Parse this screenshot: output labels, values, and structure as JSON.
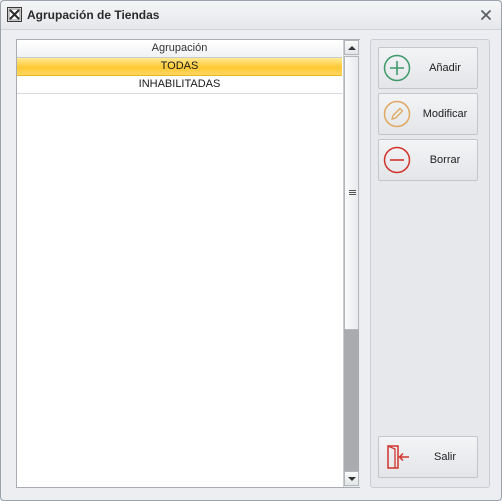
{
  "window": {
    "title": "Agrupación de Tiendas"
  },
  "grid": {
    "header": "Agrupación",
    "rows": [
      "TODAS",
      "INHABILITADAS"
    ],
    "selected_index": 0
  },
  "buttons": {
    "add_label": "Añadir",
    "modify_label": "Modificar",
    "delete_label": "Borrar",
    "exit_label": "Salir"
  },
  "colors": {
    "selection": "#ffc935",
    "add_icon": "#3f9a6b",
    "modify_icon": "#e0a860",
    "delete_icon": "#d0342c",
    "exit_icon": "#d0342c"
  },
  "icons": {
    "app": "app-icon",
    "close": "close-icon",
    "add": "plus-circle-icon",
    "modify": "pencil-circle-icon",
    "delete": "minus-circle-icon",
    "exit": "exit-door-icon"
  }
}
